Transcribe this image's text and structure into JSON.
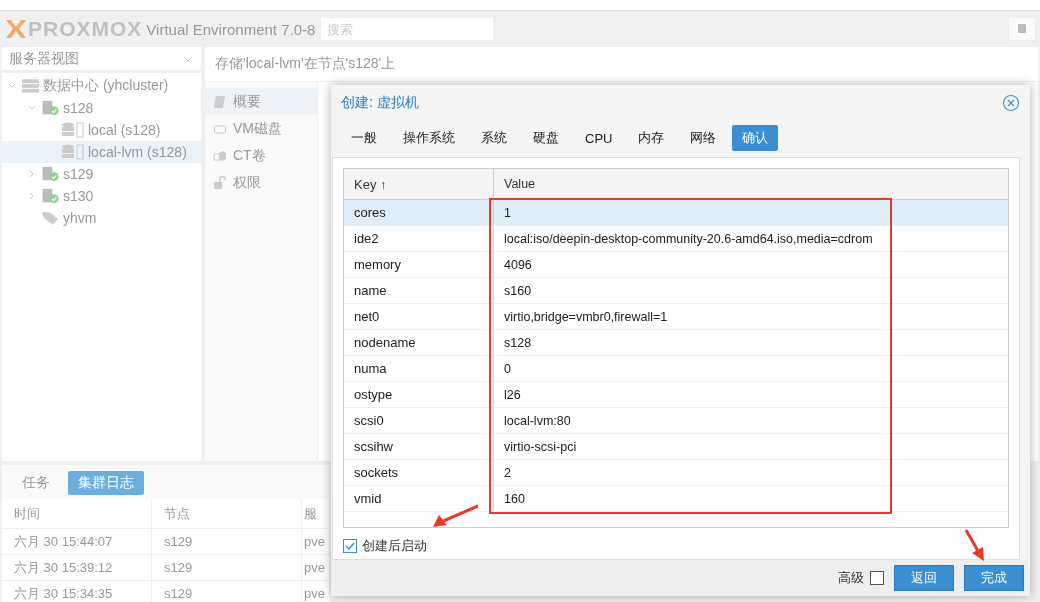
{
  "header": {
    "logo": "PROXMOX",
    "product": "Virtual Environment 7.0-8",
    "search": {
      "placeholder": "搜索"
    }
  },
  "view_selector": "服务器视图",
  "tree": [
    {
      "label": "数据中心 (yhcluster)",
      "kind": "datacenter",
      "expanded": true,
      "selected": false,
      "children": [
        {
          "label": "s128",
          "kind": "node",
          "expanded": true,
          "selected": false,
          "children": [
            {
              "label": "local (s128)",
              "kind": "storage",
              "selected": false
            },
            {
              "label": "local-lvm (s128)",
              "kind": "storage",
              "selected": true
            }
          ]
        },
        {
          "label": "s129",
          "kind": "node",
          "expanded": false,
          "selected": false
        },
        {
          "label": "s130",
          "kind": "node",
          "expanded": false,
          "selected": false
        },
        {
          "label": "yhvm",
          "kind": "pool",
          "selected": false
        }
      ]
    }
  ],
  "content_title": "存储'local-lvm'在节点's128'上",
  "nav": [
    {
      "label": "概要",
      "kind": "summary",
      "selected": true
    },
    {
      "label": "VM磁盘",
      "kind": "disk",
      "selected": false
    },
    {
      "label": "CT卷",
      "kind": "volume",
      "selected": false
    },
    {
      "label": "权限",
      "kind": "lock",
      "selected": false
    }
  ],
  "log_panel": {
    "tabs": [
      {
        "label": "任务",
        "selected": false
      },
      {
        "label": "集群日志",
        "selected": true
      }
    ],
    "columns": [
      "时间",
      "节点",
      "服"
    ],
    "rows": [
      [
        "六月 30 15:44:07",
        "s129",
        "pve"
      ],
      [
        "六月 30 15:39:12",
        "s129",
        "pve"
      ],
      [
        "六月 30 15:34:35",
        "s129",
        "pve"
      ]
    ]
  },
  "dialog": {
    "title": "创建: 虚拟机",
    "tabs": [
      {
        "label": "一般",
        "selected": false
      },
      {
        "label": "操作系统",
        "selected": false
      },
      {
        "label": "系统",
        "selected": false
      },
      {
        "label": "硬盘",
        "selected": false
      },
      {
        "label": "CPU",
        "selected": false
      },
      {
        "label": "内存",
        "selected": false
      },
      {
        "label": "网络",
        "selected": false
      },
      {
        "label": "确认",
        "selected": true
      }
    ],
    "columns": [
      "Key ↑",
      "Value"
    ],
    "rows": [
      {
        "key": "cores",
        "value": "1",
        "selected": true
      },
      {
        "key": "ide2",
        "value": "local:iso/deepin-desktop-community-20.6-amd64.iso,media=cdrom",
        "selected": false
      },
      {
        "key": "memory",
        "value": "4096",
        "selected": false
      },
      {
        "key": "name",
        "value": "s160",
        "selected": false
      },
      {
        "key": "net0",
        "value": "virtio,bridge=vmbr0,firewall=1",
        "selected": false
      },
      {
        "key": "nodename",
        "value": "s128",
        "selected": false
      },
      {
        "key": "numa",
        "value": "0",
        "selected": false
      },
      {
        "key": "ostype",
        "value": "l26",
        "selected": false
      },
      {
        "key": "scsi0",
        "value": "local-lvm:80",
        "selected": false
      },
      {
        "key": "scsihw",
        "value": "virtio-scsi-pci",
        "selected": false
      },
      {
        "key": "sockets",
        "value": "2",
        "selected": false
      },
      {
        "key": "vmid",
        "value": "160",
        "selected": false
      }
    ],
    "start_after_create": {
      "label": "创建后启动",
      "checked": true
    },
    "advanced": {
      "label": "高级",
      "checked": false
    },
    "buttons": [
      "返回",
      "完成"
    ]
  }
}
